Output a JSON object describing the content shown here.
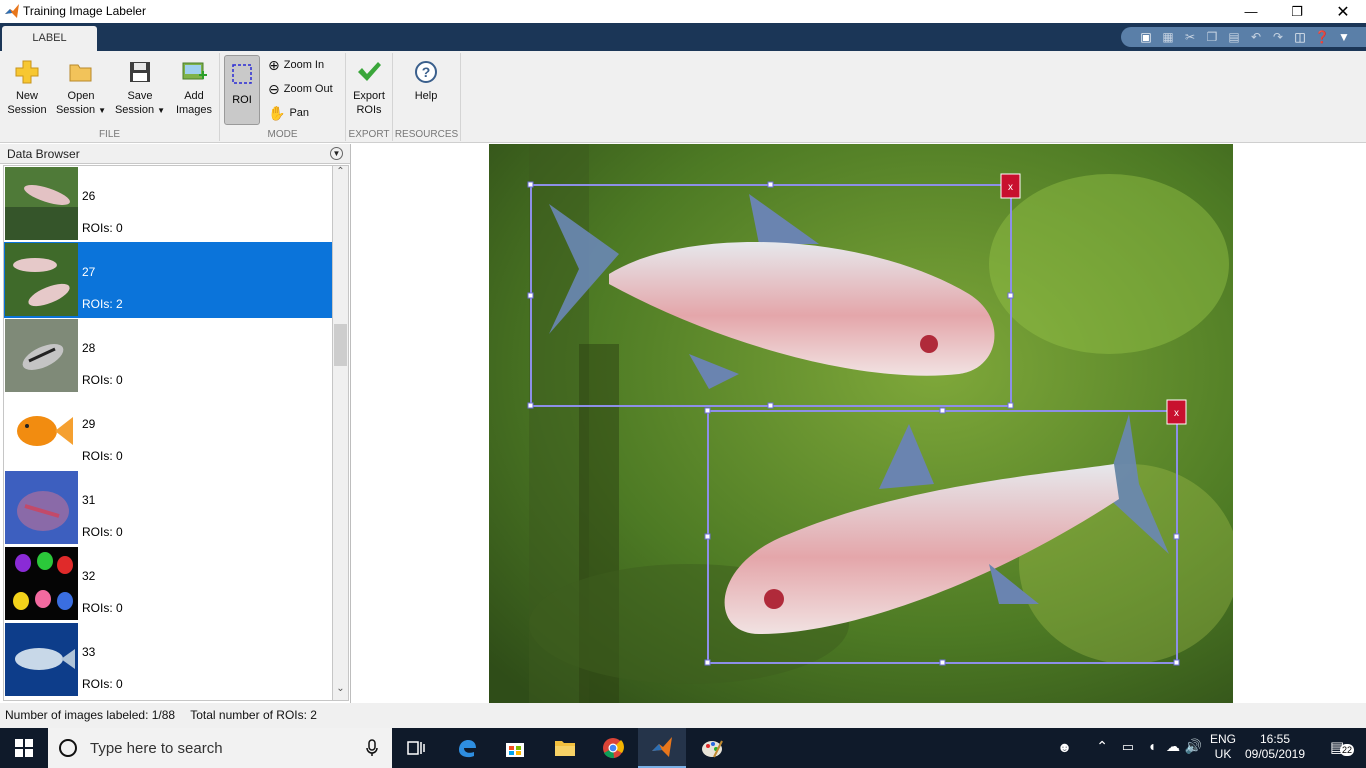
{
  "window": {
    "title": "Training Image Labeler"
  },
  "tabs": [
    {
      "label": "LABEL"
    }
  ],
  "toolstrip": {
    "file": {
      "new_session": [
        "New",
        "Session"
      ],
      "open_session": [
        "Open",
        "Session"
      ],
      "save_session": [
        "Save",
        "Session"
      ],
      "add_images": [
        "Add",
        "Images"
      ],
      "section": "FILE"
    },
    "mode": {
      "roi": "ROI",
      "zoom_in": "Zoom In",
      "zoom_out": "Zoom Out",
      "pan": "Pan",
      "section": "MODE"
    },
    "export": {
      "export_rois": [
        "Export",
        "ROIs"
      ],
      "section": "EXPORT"
    },
    "resources": {
      "help": "Help",
      "section": "RESOURCES"
    }
  },
  "browser": {
    "title": "Data Browser",
    "items": [
      {
        "id": "26",
        "rois": "ROIs: 0",
        "selected": false
      },
      {
        "id": "27",
        "rois": "ROIs: 2",
        "selected": true
      },
      {
        "id": "28",
        "rois": "ROIs: 0",
        "selected": false
      },
      {
        "id": "29",
        "rois": "ROIs: 0",
        "selected": false
      },
      {
        "id": "31",
        "rois": "ROIs: 0",
        "selected": false
      },
      {
        "id": "32",
        "rois": "ROIs: 0",
        "selected": false
      },
      {
        "id": "33",
        "rois": "ROIs: 0",
        "selected": false
      }
    ]
  },
  "canvas": {
    "roi_boxes": [
      {
        "delete_label": "x"
      },
      {
        "delete_label": "x"
      }
    ]
  },
  "status": {
    "labeled": "Number of images labeled: 1/88",
    "total": "Total number of ROIs: 2"
  },
  "taskbar": {
    "search_placeholder": "Type here to search",
    "lang": "ENG",
    "region": "UK",
    "time": "16:55",
    "date": "09/05/2019",
    "notifications": "22"
  },
  "colors": {
    "selection": "#0b74da",
    "tabbar": "#1b3657",
    "roi_box": "#8d8fe8",
    "roi_delete": "#c8102e"
  }
}
